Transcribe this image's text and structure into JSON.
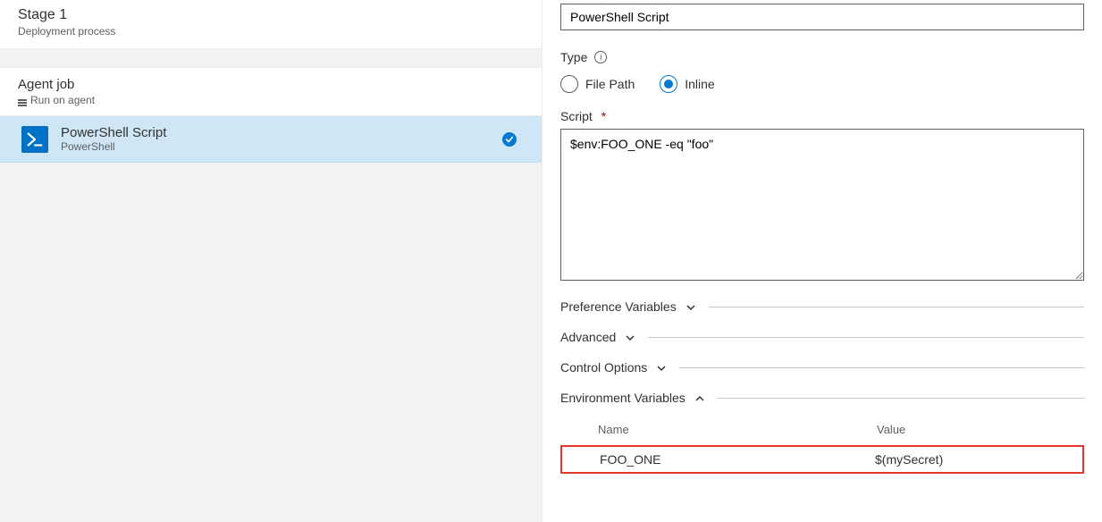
{
  "left": {
    "stage_title": "Stage 1",
    "stage_sub": "Deployment process",
    "agent_title": "Agent job",
    "agent_sub": "Run on agent",
    "task": {
      "title": "PowerShell Script",
      "sub": "PowerShell",
      "icon_glyph": ">_"
    }
  },
  "right": {
    "displayname_value": "PowerShell Script",
    "type_label": "Type",
    "radio_filepath": "File Path",
    "radio_inline": "Inline",
    "radio_selected": "inline",
    "script_label": "Script",
    "script_value": "$env:FOO_ONE -eq \"foo\"",
    "sections": {
      "pref": "Preference Variables",
      "adv": "Advanced",
      "ctrl": "Control Options",
      "env": "Environment Variables"
    },
    "env_table": {
      "header_name": "Name",
      "header_value": "Value",
      "rows": [
        {
          "name": "FOO_ONE",
          "value": "$(mySecret)"
        }
      ]
    }
  }
}
